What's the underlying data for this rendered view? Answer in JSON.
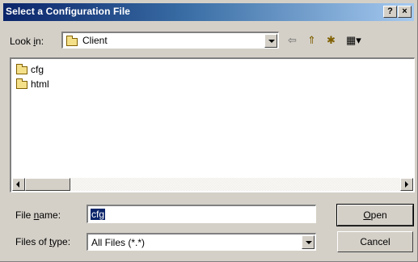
{
  "window": {
    "title": "Select a Configuration File",
    "help_button": "?",
    "close_button": "×"
  },
  "look_in": {
    "label_pre": "Look ",
    "label_accel": "i",
    "label_post": "n:",
    "value": "Client",
    "toolbar": {
      "back": "⇦",
      "up_folder": "⇑",
      "new_folder": "✱",
      "view_menu": "▦▾"
    }
  },
  "files": [
    {
      "name": "cfg",
      "type": "folder-icon"
    },
    {
      "name": "html",
      "type": "folder-icon"
    }
  ],
  "file_name": {
    "label_pre": "File ",
    "label_accel": "n",
    "label_post": "ame:",
    "value": "cfg"
  },
  "files_of_type": {
    "label_pre": "Files of ",
    "label_accel": "t",
    "label_post": "ype:",
    "value": "All Files (*.*)"
  },
  "buttons": {
    "open_accel": "O",
    "open_rest": "pen",
    "cancel": "Cancel"
  },
  "colors": {
    "title_start": "#0a246a",
    "title_end": "#a6caf0",
    "face": "#d4d0c8",
    "selection": "#0a246a"
  }
}
